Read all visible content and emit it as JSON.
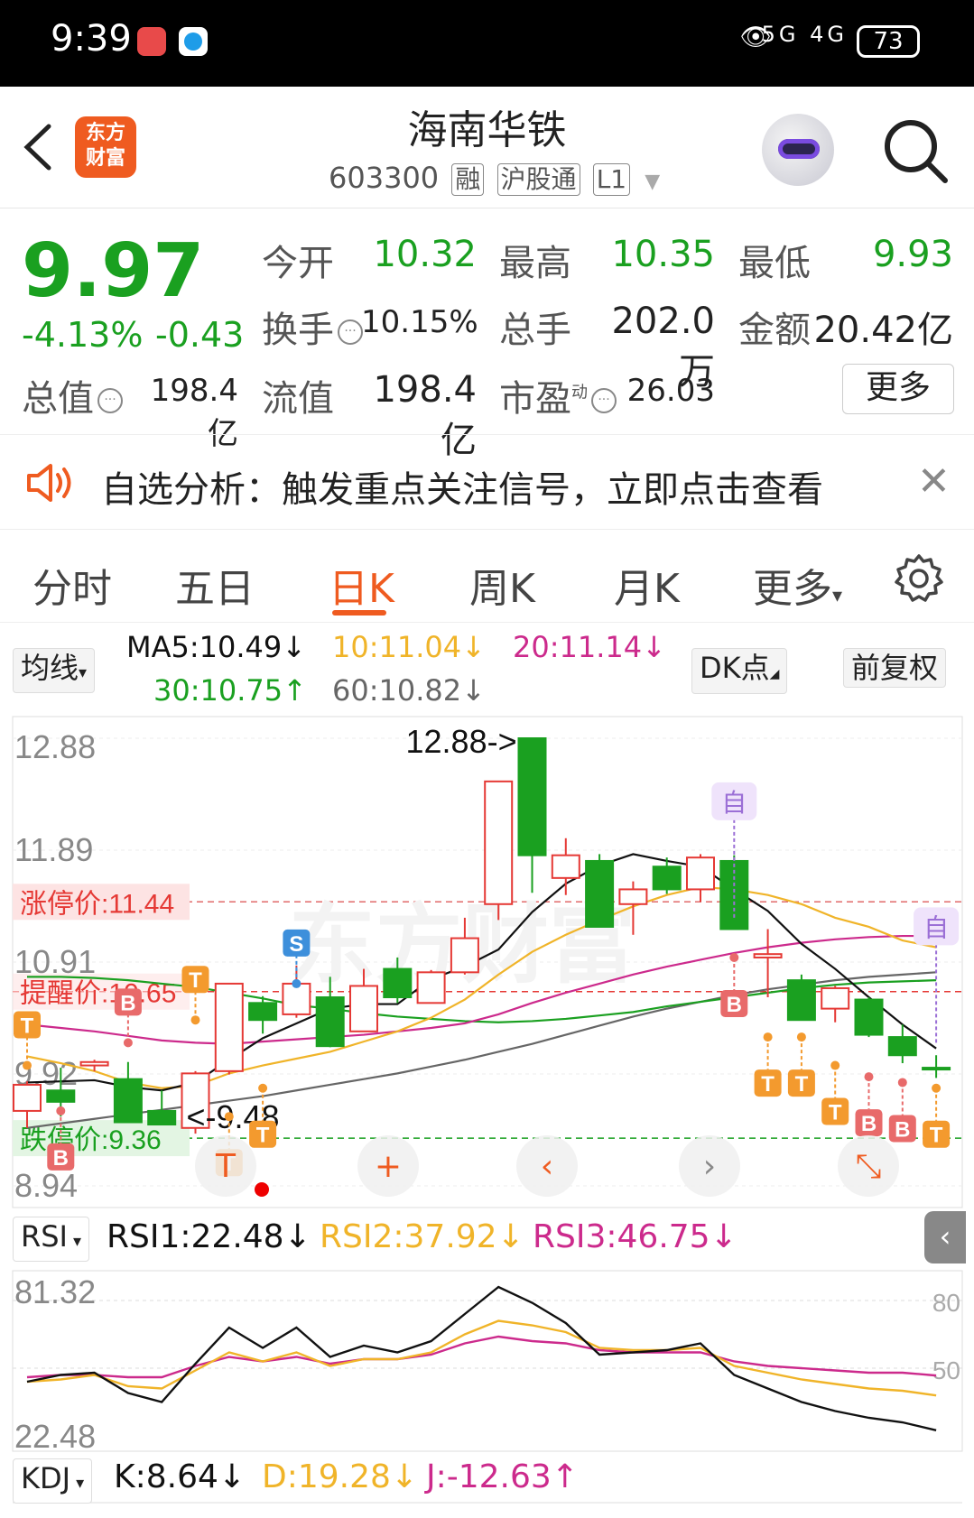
{
  "status_bar": {
    "time": "9:39",
    "network": "5G 4G",
    "battery": "73"
  },
  "header": {
    "logo_text": "东方财富",
    "stock_name": "海南华铁",
    "stock_code": "603300",
    "tags": [
      "融",
      "沪股通",
      "L1"
    ]
  },
  "quote": {
    "price": "9.97",
    "change_pct": "-4.13%",
    "change_abs": "-0.43",
    "open_label": "今开",
    "open": "10.32",
    "high_label": "最高",
    "high": "10.35",
    "low_label": "最低",
    "low": "9.93",
    "turnover_label": "换手",
    "turnover": "10.15%",
    "volume_label": "总手",
    "volume": "202.0万",
    "amount_label": "金额",
    "amount": "20.42亿",
    "mktcap_label": "总值",
    "mktcap": "198.4亿",
    "float_label": "流值",
    "float_cap": "198.4亿",
    "pe_label": "市盈",
    "pe_sup": "动",
    "pe": "26.03",
    "more_label": "更多"
  },
  "notice": {
    "text": "自选分析：触发重点关注信号，立即点击查看"
  },
  "tabs": {
    "items": [
      "分时",
      "五日",
      "日K",
      "周K",
      "月K",
      "更多"
    ],
    "active": "日K"
  },
  "ma_bar": {
    "ma_select": "均线",
    "ma5": "MA5:10.49↓",
    "ma10": "10:11.04↓",
    "ma20": "20:11.14↓",
    "ma30": "30:10.75↑",
    "ma60": "60:10.82↓",
    "dk_label": "DK点",
    "adjust_label": "前复权"
  },
  "kline": {
    "y_labels": [
      "12.88",
      "11.89",
      "10.91",
      "9.92",
      "8.94"
    ],
    "max_annotation": "12.88->",
    "min_annotation": "<-9.48",
    "limit_up_label": "涨停价:11.44",
    "limit_down_label": "跌停价:9.36",
    "alert_label": "提醒价:10.65",
    "signal_labels": {
      "S": "S",
      "B": "B",
      "T": "T",
      "self": "自"
    },
    "colors": {
      "up": "#e53935",
      "down": "#1aa020",
      "ma5": "#111111",
      "ma10": "#f0b429",
      "ma20": "#cc2a8c",
      "ma30": "#1aa020",
      "ma60": "#666666"
    }
  },
  "chart_data": {
    "type": "candlestick",
    "candles": [
      {
        "o": 9.6,
        "h": 9.86,
        "l": 9.45,
        "c": 9.83
      },
      {
        "o": 9.78,
        "h": 9.98,
        "l": 9.55,
        "c": 9.68
      },
      {
        "o": 10.0,
        "h": 10.05,
        "l": 9.95,
        "c": 10.03
      },
      {
        "o": 9.88,
        "h": 10.03,
        "l": 9.5,
        "c": 9.5
      },
      {
        "o": 9.6,
        "h": 9.78,
        "l": 9.48,
        "c": 9.48
      },
      {
        "o": 9.45,
        "h": 9.95,
        "l": 9.4,
        "c": 9.93
      },
      {
        "o": 9.95,
        "h": 10.72,
        "l": 9.92,
        "c": 10.72
      },
      {
        "o": 10.55,
        "h": 10.61,
        "l": 10.28,
        "c": 10.4
      },
      {
        "o": 10.45,
        "h": 10.88,
        "l": 10.42,
        "c": 10.72
      },
      {
        "o": 10.6,
        "h": 10.78,
        "l": 10.16,
        "c": 10.17
      },
      {
        "o": 10.3,
        "h": 10.85,
        "l": 10.3,
        "c": 10.7
      },
      {
        "o": 10.85,
        "h": 10.95,
        "l": 10.55,
        "c": 10.6
      },
      {
        "o": 10.55,
        "h": 10.84,
        "l": 10.55,
        "c": 10.82
      },
      {
        "o": 10.82,
        "h": 11.3,
        "l": 10.8,
        "c": 11.12
      },
      {
        "o": 11.42,
        "h": 12.5,
        "l": 11.28,
        "c": 12.5
      },
      {
        "o": 12.88,
        "h": 12.88,
        "l": 11.52,
        "c": 11.85
      },
      {
        "o": 11.65,
        "h": 12.0,
        "l": 11.5,
        "c": 11.85
      },
      {
        "o": 11.8,
        "h": 11.86,
        "l": 11.22,
        "c": 11.22
      },
      {
        "o": 11.42,
        "h": 11.62,
        "l": 11.15,
        "c": 11.55
      },
      {
        "o": 11.75,
        "h": 11.83,
        "l": 11.51,
        "c": 11.55
      },
      {
        "o": 11.55,
        "h": 11.86,
        "l": 11.44,
        "c": 11.83
      },
      {
        "o": 11.8,
        "h": 11.85,
        "l": 11.2,
        "c": 11.2
      },
      {
        "o": 10.95,
        "h": 11.2,
        "l": 10.6,
        "c": 10.98
      },
      {
        "o": 10.75,
        "h": 10.8,
        "l": 10.4,
        "c": 10.4
      },
      {
        "o": 10.5,
        "h": 10.7,
        "l": 10.38,
        "c": 10.68
      },
      {
        "o": 10.58,
        "h": 10.6,
        "l": 10.25,
        "c": 10.27
      },
      {
        "o": 10.25,
        "h": 10.36,
        "l": 10.02,
        "c": 10.09
      },
      {
        "o": 9.98,
        "h": 10.09,
        "l": 9.89,
        "c": 9.97
      }
    ],
    "ma5": [
      9.85,
      9.86,
      9.87,
      9.81,
      9.78,
      9.85,
      10.05,
      10.24,
      10.37,
      10.5,
      10.54,
      10.54,
      10.76,
      10.87,
      11.02,
      11.35,
      11.6,
      11.76,
      11.86,
      11.8,
      11.75,
      11.55,
      11.36,
      11.07,
      10.85,
      10.6,
      10.36,
      10.15
    ],
    "ma10": [
      10.08,
      10.02,
      9.95,
      9.85,
      9.8,
      9.82,
      9.93,
      10.0,
      10.06,
      10.12,
      10.21,
      10.3,
      10.42,
      10.58,
      10.8,
      11.0,
      11.15,
      11.28,
      11.4,
      11.5,
      11.57,
      11.55,
      11.5,
      11.42,
      11.3,
      11.22,
      11.1,
      11.04
    ],
    "ma20": [
      10.36,
      10.33,
      10.3,
      10.26,
      10.22,
      10.2,
      10.19,
      10.21,
      10.23,
      10.25,
      10.27,
      10.3,
      10.33,
      10.37,
      10.45,
      10.55,
      10.64,
      10.72,
      10.8,
      10.87,
      10.93,
      10.99,
      11.04,
      11.08,
      11.11,
      11.13,
      11.14,
      11.14
    ],
    "ma30": [
      10.78,
      10.78,
      10.77,
      10.75,
      10.72,
      10.69,
      10.64,
      10.59,
      10.53,
      10.5,
      10.46,
      10.43,
      10.41,
      10.39,
      10.38,
      10.39,
      10.41,
      10.44,
      10.47,
      10.52,
      10.56,
      10.6,
      10.64,
      10.68,
      10.71,
      10.73,
      10.74,
      10.75
    ],
    "ma60": [
      9.45,
      9.49,
      9.53,
      9.57,
      9.61,
      9.65,
      9.69,
      9.73,
      9.78,
      9.83,
      9.88,
      9.93,
      9.99,
      10.05,
      10.12,
      10.19,
      10.27,
      10.35,
      10.43,
      10.5,
      10.56,
      10.62,
      10.67,
      10.71,
      10.75,
      10.78,
      10.8,
      10.82
    ],
    "y_range": [
      8.94,
      12.88
    ],
    "limit_up": 11.44,
    "limit_down": 9.36,
    "alert_price": 10.65
  },
  "rsi": {
    "select": "RSI",
    "rsi1": "RSI1:22.48↓",
    "rsi2": "RSI2:37.92↓",
    "rsi3": "RSI3:46.75↓",
    "y_top": "81.32",
    "y_bottom": "22.48",
    "right_80": "80",
    "right_50": "50",
    "rsi1_values": [
      44,
      47,
      48,
      39,
      35,
      52,
      68,
      59,
      68,
      55,
      60,
      57,
      62,
      74,
      86,
      79,
      70,
      56,
      57,
      58,
      61,
      47,
      41,
      35,
      31,
      28,
      26,
      22.48
    ],
    "rsi2_values": [
      44,
      45,
      47,
      42,
      41,
      49,
      57,
      53,
      57,
      51,
      54,
      54,
      57,
      65,
      71,
      69,
      66,
      59,
      58,
      58,
      59,
      51,
      48,
      45,
      43,
      41,
      40,
      37.92
    ],
    "rsi3_values": [
      46,
      47,
      47,
      46,
      46,
      51,
      55,
      53,
      55,
      52,
      54,
      54,
      56,
      61,
      64,
      62,
      61,
      58,
      57,
      57,
      57,
      53,
      51,
      50,
      49,
      48,
      48,
      46.75
    ]
  },
  "kdj": {
    "select": "KDJ",
    "k": "K:8.64↓",
    "d": "D:19.28↓",
    "j": "J:-12.63↑"
  }
}
